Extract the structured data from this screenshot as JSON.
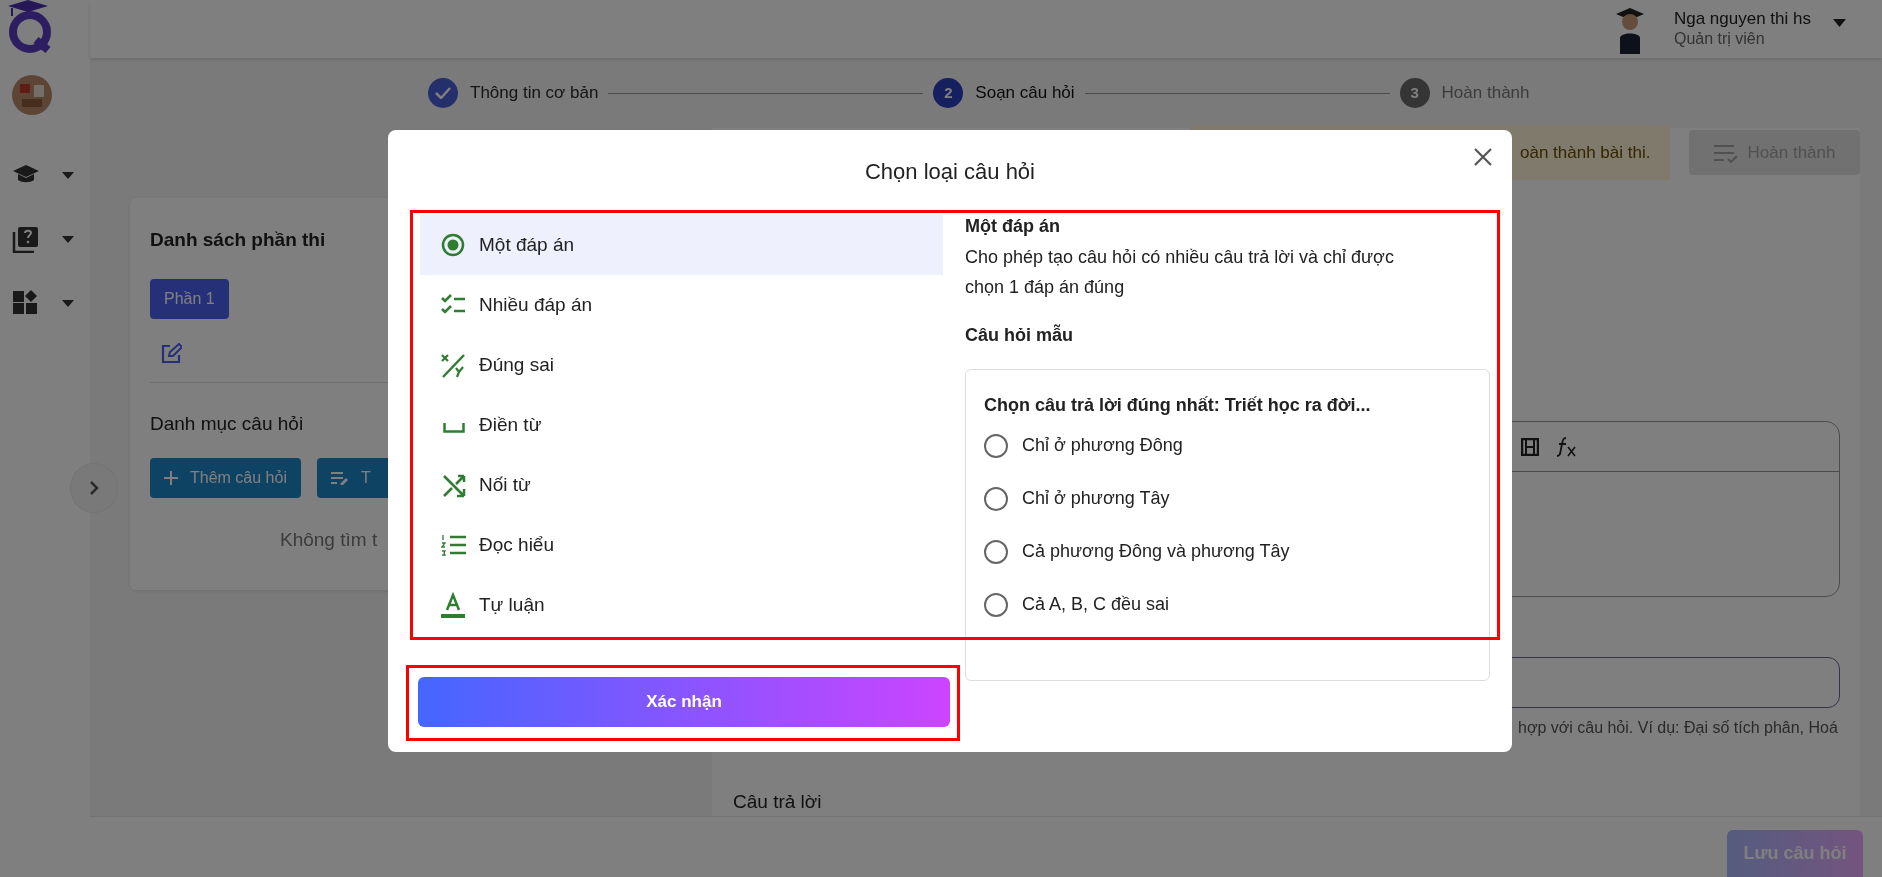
{
  "header": {
    "user_name": "Nga nguyen thi hs",
    "user_role": "Quản trị viên"
  },
  "stepper": [
    {
      "label": "Thông tin cơ bản",
      "completed": true,
      "selected": false
    },
    {
      "number": "2",
      "label": "Soạn câu hỏi",
      "completed": false,
      "selected": true
    },
    {
      "number": "3",
      "label": "Hoàn thành",
      "completed": false,
      "selected": false
    }
  ],
  "alert": {
    "text": "oàn thành bài thi."
  },
  "finish_button": {
    "label": "Hoàn thành",
    "disabled": true
  },
  "sections_card": {
    "title": "Danh sách phần thi",
    "parts": [
      {
        "label": "Phần 1",
        "selected": true
      }
    ],
    "category_title": "Danh mục câu hỏi",
    "add_button": "Thêm câu hỏi",
    "second_button": "T",
    "empty_text": "Không tìm t"
  },
  "hint_text": "hợp với câu hỏi. Ví dụ: Đại số tích phân, Hoá",
  "answers_label": "Câu trả lời",
  "save_button": {
    "label": "Lưu câu hỏi",
    "disabled": true
  },
  "modal": {
    "title": "Chọn loại câu hỏi",
    "types": [
      {
        "kind": "single",
        "label": "Một đáp án",
        "selected": true
      },
      {
        "kind": "multiple",
        "label": "Nhiều đáp án",
        "selected": false
      },
      {
        "kind": "truefalse",
        "label": "Đúng sai",
        "selected": false
      },
      {
        "kind": "fill",
        "label": "Điền từ",
        "selected": false
      },
      {
        "kind": "matching",
        "label": "Nối từ",
        "selected": false
      },
      {
        "kind": "reading",
        "label": "Đọc hiểu",
        "selected": false
      },
      {
        "kind": "essay",
        "label": "Tự luận",
        "selected": false
      }
    ],
    "detail": {
      "title": "Một đáp án",
      "description": "Cho phép tạo câu hỏi có nhiều câu trả lời và chỉ được chọn 1 đáp án đúng",
      "sample_heading": "Câu hỏi mẫu",
      "sample": {
        "question": "Chọn câu trả lời đúng nhất: Triết học ra đời...",
        "options": [
          {
            "label": "Chỉ ở phương Đông",
            "selected": false
          },
          {
            "label": "Chỉ ở phương Tây",
            "selected": false
          },
          {
            "label": "Cả phương Đông và phương Tây",
            "selected": false
          },
          {
            "label": "Cả A, B, C đều sai",
            "selected": false
          }
        ]
      }
    },
    "confirm_button": "Xác nhận"
  }
}
